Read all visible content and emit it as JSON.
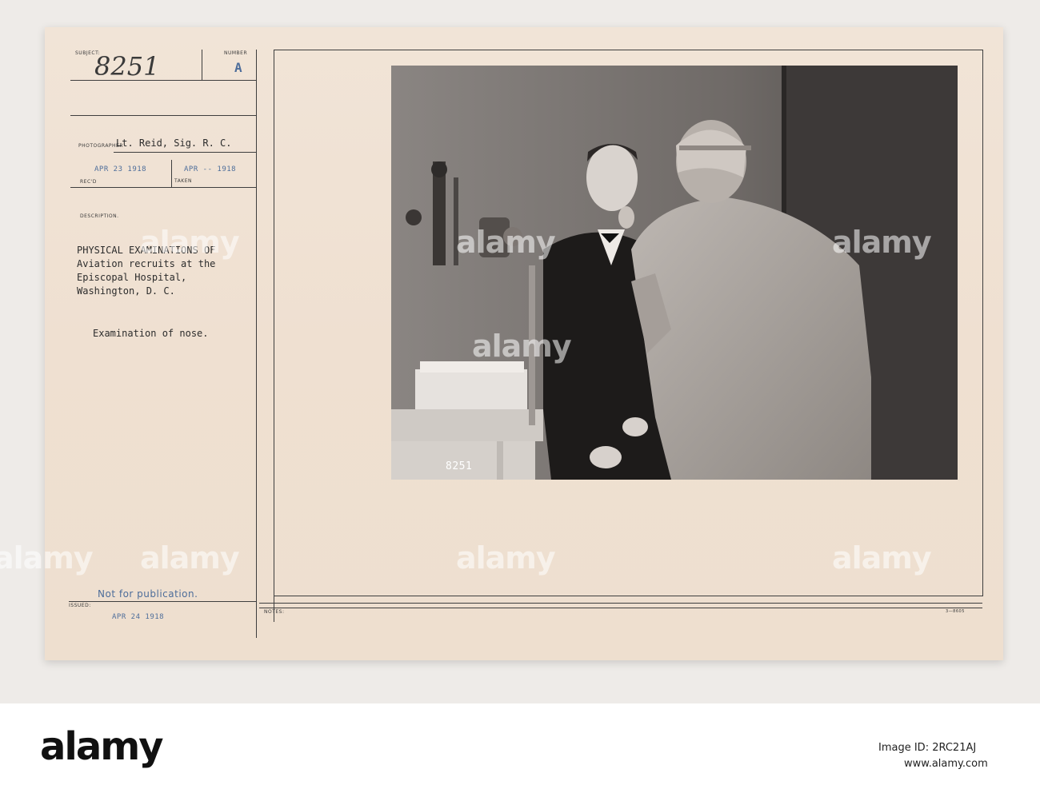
{
  "card": {
    "subject_label": "SUBJECT:",
    "subject_value": "8251",
    "number_label": "NUMBER",
    "number_value": "A",
    "photographer_label": "PHOTOGRAPHER",
    "photographer_value": "Lt. Reid, Sig. R. C.",
    "recd_label": "REC'D",
    "recd_value": "APR 23 1918",
    "taken_label": "TAKEN",
    "taken_value": "APR -- 1918",
    "description_label": "DESCRIPTION.",
    "description_lines": [
      "PHYSICAL EXAMINATIONS OF",
      "Aviation recruits at the",
      "Episcopal Hospital,",
      "Washington, D. C."
    ],
    "examination_text": "Examination of nose.",
    "not_for_publication": "Not for publication.",
    "issued_label": "ISSUED:",
    "issued_value": "APR 24 1918",
    "notes_label": "NOTES:",
    "form_code": "3—8605",
    "photo_stamp": "8251"
  },
  "watermark": {
    "text": "alamy"
  },
  "footer": {
    "brand": "alamy",
    "image_id_line": "Image ID: 2RC21AJ",
    "site": "www.alamy.com"
  },
  "colors": {
    "card_paper": "#efe1d2",
    "stamp_blue": "#4d6d9a",
    "ink": "#2c2c2c"
  }
}
